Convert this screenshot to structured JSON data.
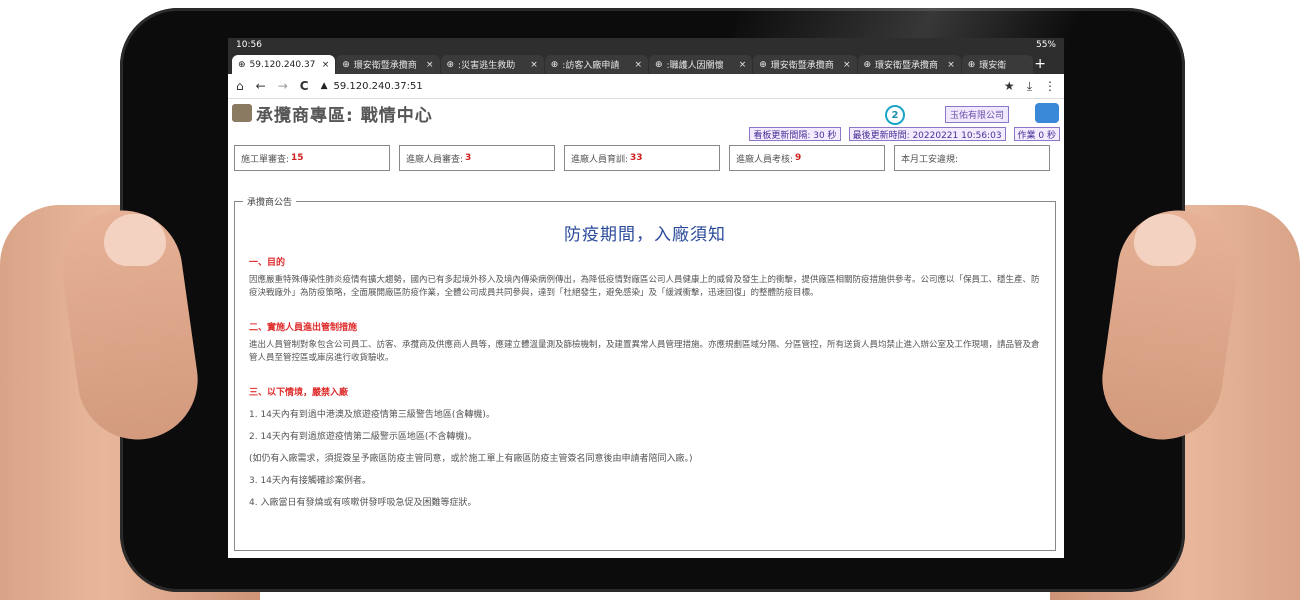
{
  "status": {
    "time": "10:56",
    "battery": "55%"
  },
  "tabs": [
    {
      "label": "59.120.240.37",
      "active": true
    },
    {
      "label": "環安衛暨承攬商",
      "active": false
    },
    {
      "label": ":災害逃生救助",
      "active": false
    },
    {
      "label": ":訪客入廠申請",
      "active": false
    },
    {
      "label": ":職護人因關懷",
      "active": false
    },
    {
      "label": "環安衛暨承攬商",
      "active": false
    },
    {
      "label": "環安衛暨承攬商",
      "active": false
    },
    {
      "label": "環安衛",
      "active": false
    }
  ],
  "newtab_label": "+",
  "address": {
    "url": "59.120.240.37:51"
  },
  "icons": {
    "home": "⌂",
    "back": "←",
    "forward": "→",
    "reload": "C",
    "warning": "▲",
    "star": "★",
    "download": "⤓",
    "menu": "⋮",
    "globe": "⊕",
    "close": "×"
  },
  "header": {
    "title": "承攬商專區: 戰情中心",
    "notification_count": "2",
    "company": "玉佑有限公司"
  },
  "infobar": {
    "refresh": "看板更新間隔: 30 秒",
    "last_update": "最後更新時間: 20220221 10:56:03",
    "work": "作業 0 秒"
  },
  "stats": [
    {
      "label": "施工單審查:",
      "value": "15"
    },
    {
      "label": "進廠人員審查:",
      "value": "3"
    },
    {
      "label": "進廠人員育訓:",
      "value": "33"
    },
    {
      "label": "進廠人員考核:",
      "value": "9"
    },
    {
      "label": "本月工安違規:",
      "value": ""
    }
  ],
  "announcement": {
    "legend": "承攬商公告",
    "title": "防疫期間，入廠須知",
    "sections": [
      {
        "heading": "一、目的",
        "text": "因應嚴重特殊傳染性肺炎疫情有擴大趨勢，國內已有多起境外移入及境內傳染病例傳出，為降低疫情對廠區公司人員健康上的威脅及發生上的衝擊，提供廠區相關防疫措施供參考。公司應以「保員工、穩生產、防疫決戰廠外」為防疫策略，全面展開廠區防疫作業，全體公司成員共同參與，達到「杜絕發生，避免感染」及「緩減衝擊，迅速回復」的整體防疫目標。"
      },
      {
        "heading": "二、實施人員進出管制措施",
        "text": "進出人員管制對象包含公司員工、訪客、承攬商及供應商人員等，應建立體溫量測及篩檢機制，及建置異常人員管理措施。亦應規劃區域分隔、分區管控，所有送貨人員均禁止進入辦公室及工作現場，請品管及倉管人員至管控區或庫房進行收貨驗收。"
      },
      {
        "heading": "三、以下情境，嚴禁入廠",
        "items": [
          "1. 14天內有到過中港澳及旅遊疫情第三級警告地區(含轉機)。",
          "2. 14天內有到過旅遊疫情第二級警示區地區(不含轉機)。",
          "(如仍有入廠需求，須提簽呈予廠區防疫主管同意，或於施工單上有廠區防疫主管簽名同意後由申請者陪同入廠。)",
          "3. 14天內有接觸確診案例者。",
          "4. 入廠當日有發燒或有咳嗽併發呼吸急促及困難等症狀。"
        ]
      }
    ]
  }
}
